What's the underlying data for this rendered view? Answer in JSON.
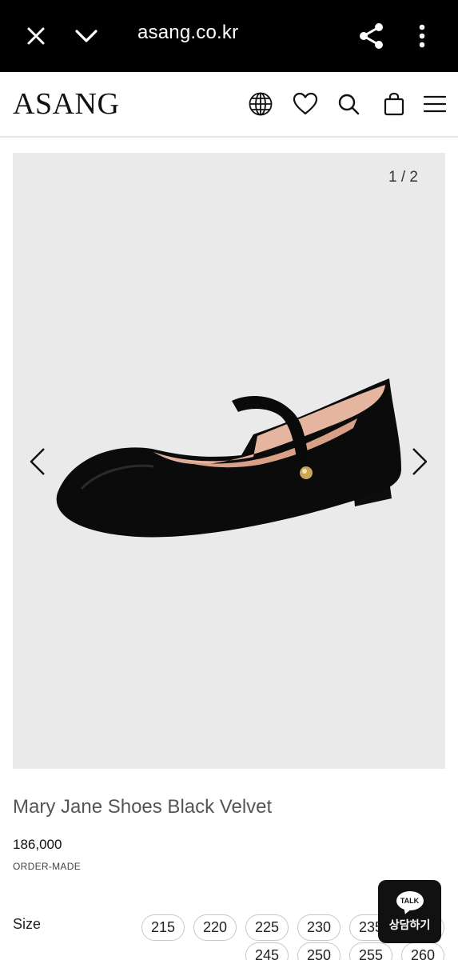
{
  "browser": {
    "url": "asang.co.kr",
    "icons": [
      "close-icon",
      "chevron-down-icon",
      "share-icon",
      "more-vert-icon"
    ]
  },
  "header": {
    "logo": "ASANG",
    "icons": [
      "globe-icon",
      "heart-icon",
      "search-icon",
      "bag-icon",
      "menu-icon"
    ]
  },
  "gallery": {
    "counter": "1 / 2",
    "current_page": 1,
    "total_pages": 2
  },
  "product": {
    "title": "Mary Jane Shoes Black Velvet",
    "price": "186,000",
    "note": "ORDER-MADE",
    "size_label": "Size",
    "sizes": [
      "215",
      "220",
      "225",
      "230",
      "235",
      "240",
      "245",
      "250",
      "255",
      "260"
    ]
  },
  "chat": {
    "badge": "TALK",
    "label": "상담하기"
  }
}
